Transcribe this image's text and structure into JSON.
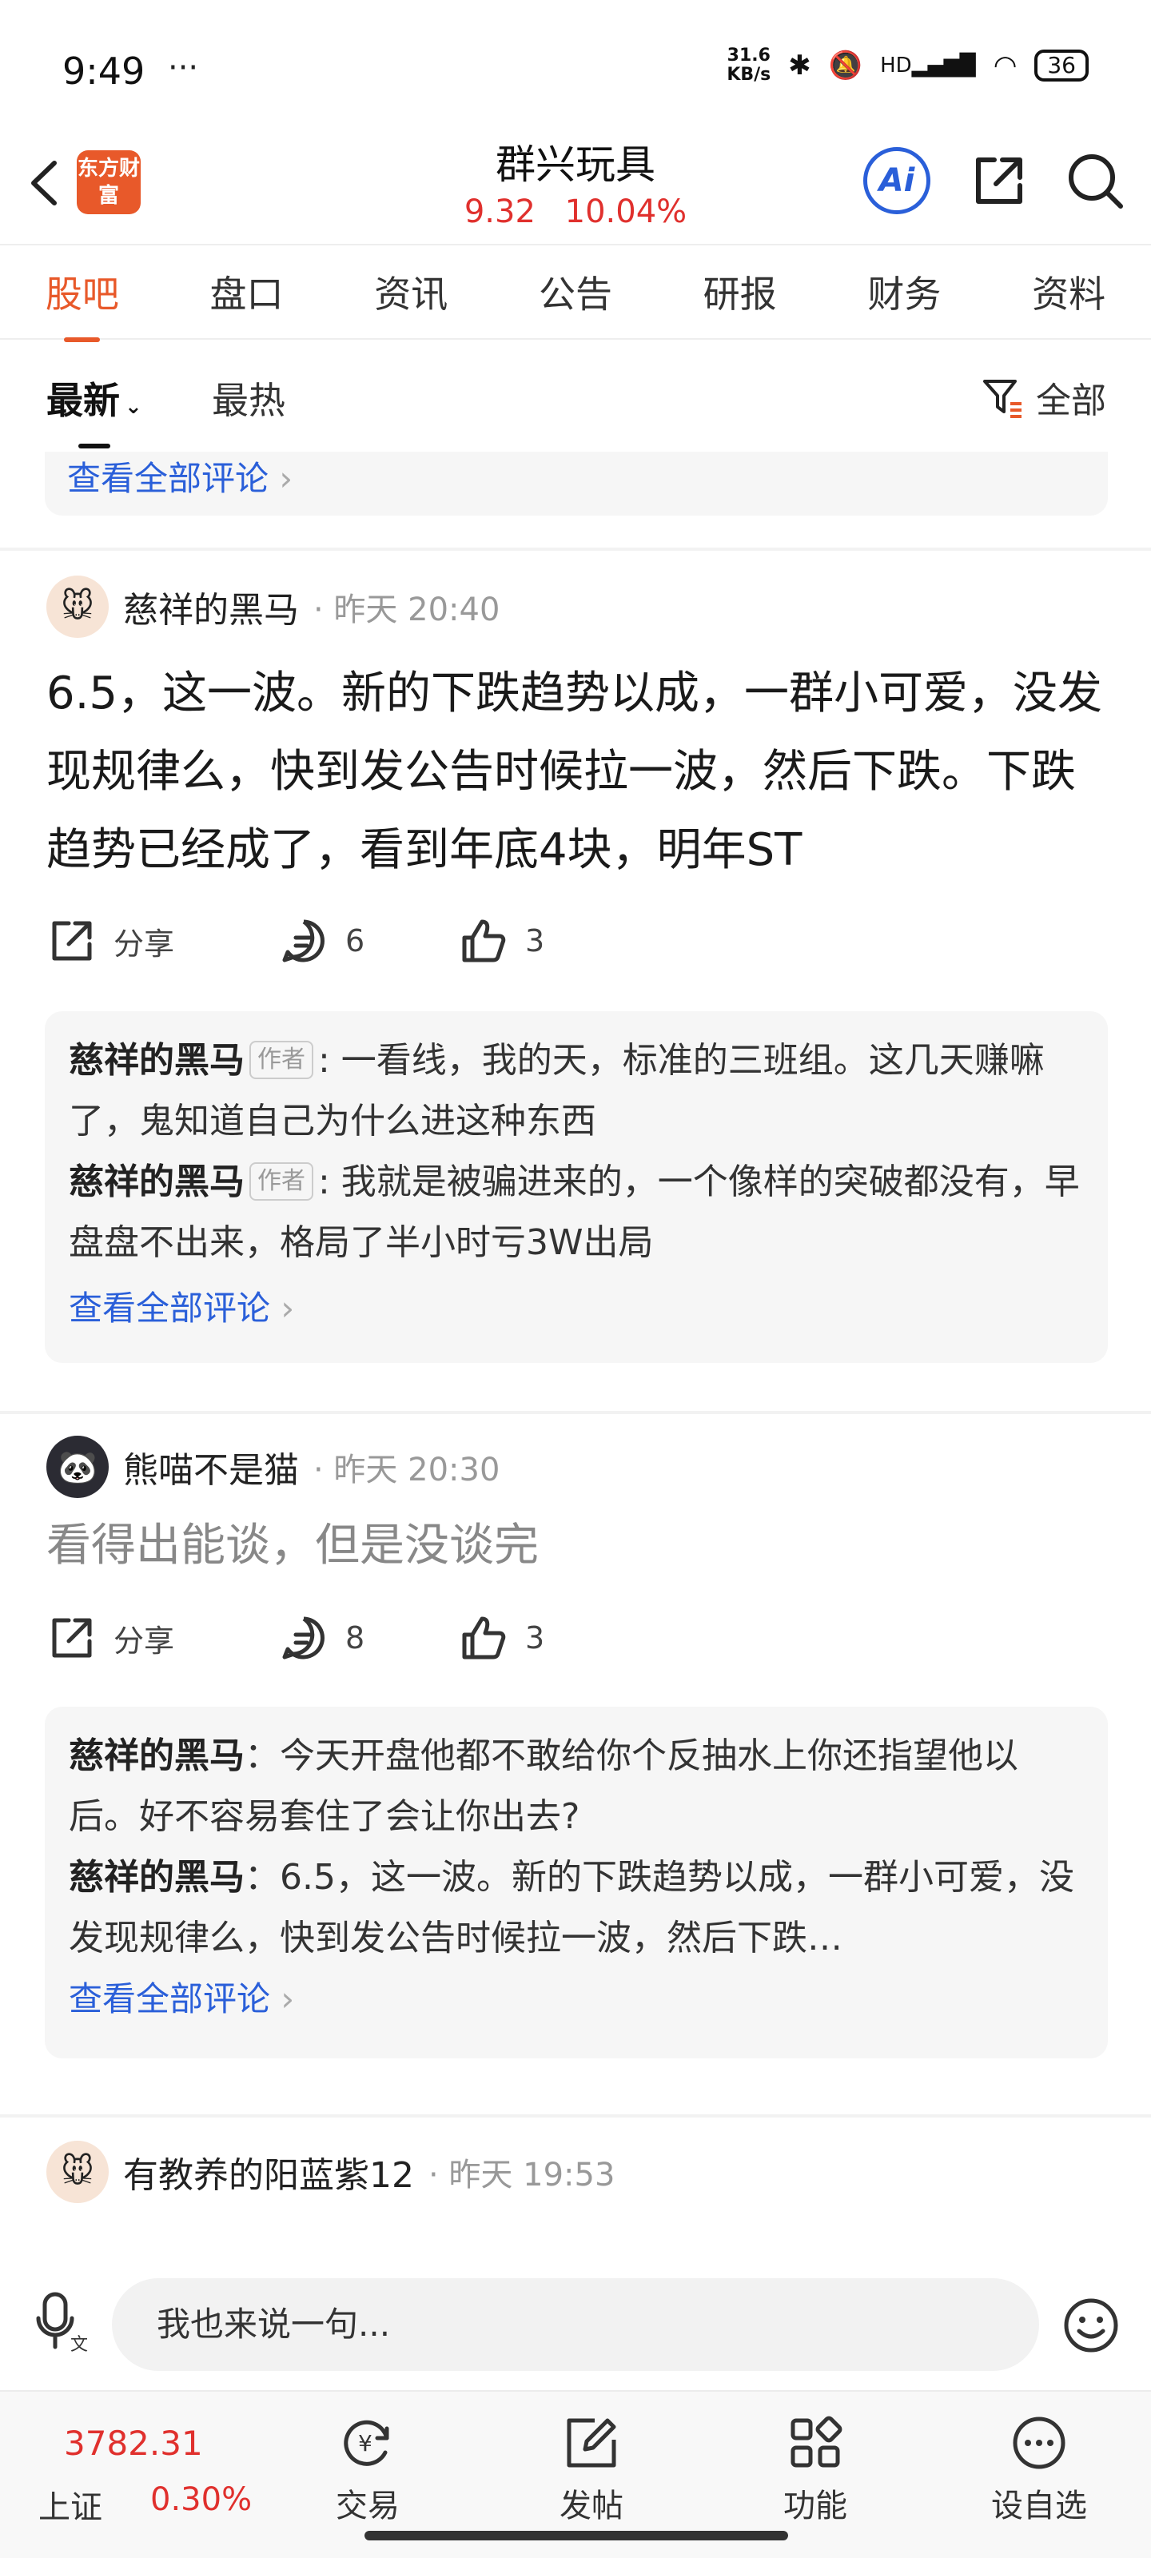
{
  "status_bar": {
    "time": "9:49",
    "dots": "···",
    "net_speed_top": "31.6",
    "net_speed_bottom": "KB/s",
    "network": "HD",
    "battery": "36"
  },
  "header": {
    "logo_text": "东方财富",
    "stock_name": "群兴玩具",
    "price": "9.32",
    "change_pct": "10.04%",
    "ai_label": "Ai"
  },
  "tabs": [
    "股吧",
    "盘口",
    "资讯",
    "公告",
    "研报",
    "财务",
    "资料"
  ],
  "filters": {
    "newest": "最新",
    "hottest": "最热",
    "all": "全部"
  },
  "partial_link": "查看全部评论",
  "posts": [
    {
      "author": "慈祥的黑马",
      "time": "· 昨天 20:40",
      "body": "6.5，这一波。新的下跌趋势以成，一群小可爱，没发现规律么，快到发公告时候拉一波，然后下跌。下跌趋势已经成了，看到年底4块，明年ST",
      "share_label": "分享",
      "comments": "6",
      "likes": "3",
      "replies": [
        {
          "name": "慈祥的黑马",
          "tag": "作者",
          "text": ": 一看线，我的天，标准的三班组。这几天赚嘛了，鬼知道自己为什么进这种东西"
        },
        {
          "name": "慈祥的黑马",
          "tag": "作者",
          "text": ": 我就是被骗进来的，一个像样的突破都没有，早盘盘不出来，格局了半小时亏3W出局"
        }
      ],
      "view_all": "查看全部评论"
    },
    {
      "author": "熊喵不是猫",
      "time": "· 昨天 20:30",
      "body": "看得出能谈，但是没谈完",
      "share_label": "分享",
      "comments": "8",
      "likes": "3",
      "replies": [
        {
          "name": "慈祥的黑马",
          "text": "：今天开盘他都不敢给你个反抽水上你还指望他以后。好不容易套住了会让你出去?"
        },
        {
          "name": "慈祥的黑马",
          "text": "：6.5，这一波。新的下跌趋势以成，一群小可爱，没发现规律么，快到发公告时候拉一波，然后下跌…"
        }
      ],
      "view_all": "查看全部评论"
    },
    {
      "author": "有教养的阳蓝紫12",
      "time": "· 昨天 19:53"
    }
  ],
  "input_placeholder": "我也来说一句...",
  "bottom_nav": {
    "index_value": "3782.31",
    "index_name": "上证",
    "index_pct": "0.30%",
    "items": [
      "交易",
      "发帖",
      "功能",
      "设自选"
    ]
  },
  "colors": {
    "accent": "#e8592a",
    "up_red": "#e0302d",
    "link_blue": "#2a5fd9"
  }
}
